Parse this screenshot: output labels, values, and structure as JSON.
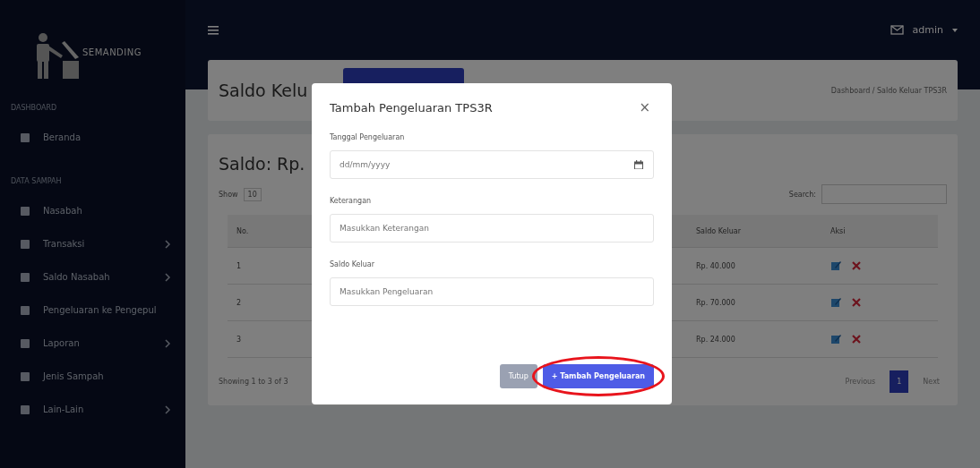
{
  "sidebar": {
    "brand": "SEMANDING",
    "items": [
      {
        "kind": "section",
        "label": "DASHBOARD"
      },
      {
        "kind": "link",
        "label": "Beranda",
        "expandable": false
      },
      {
        "kind": "section",
        "label": "DATA SAMPAH"
      },
      {
        "kind": "link",
        "label": "Nasabah",
        "expandable": false
      },
      {
        "kind": "link",
        "label": "Transaksi",
        "expandable": true
      },
      {
        "kind": "link",
        "label": "Saldo Nasabah",
        "expandable": true
      },
      {
        "kind": "link",
        "label": "Pengeluaran ke Pengepul",
        "expandable": false
      },
      {
        "kind": "link",
        "label": "Laporan",
        "expandable": true
      },
      {
        "kind": "link",
        "label": "Jenis Sampah",
        "expandable": false
      },
      {
        "kind": "link",
        "label": "Lain-Lain",
        "expandable": true
      }
    ]
  },
  "topbar": {
    "user": "admin"
  },
  "page_header": {
    "title": "Saldo Kelu",
    "breadcrumb": "Dashboard / Saldo Keluar TPS3R"
  },
  "card": {
    "title": "Saldo: Rp.",
    "show_label": "Show",
    "show_value": "10",
    "search_label": "Search:",
    "table": {
      "columns": [
        "No.",
        "Saldo Keluar",
        "Aksi"
      ],
      "rows": [
        {
          "no": "1",
          "amount": "Rp. 40.000"
        },
        {
          "no": "2",
          "amount": "Rp. 70.000"
        },
        {
          "no": "3",
          "amount": "Rp. 24.000"
        }
      ]
    },
    "info": "Showing 1 to 3 of 3",
    "pagination": [
      {
        "label": "Previous",
        "selected": false
      },
      {
        "label": "1",
        "selected": true
      },
      {
        "label": "Next",
        "selected": false
      }
    ]
  },
  "modal": {
    "title": "Tambah Pengeluaran TPS3R",
    "close": "×",
    "fields": [
      {
        "label": "Tanggal Pengeluaran",
        "kind": "date",
        "value": "dd/mm/yyyy"
      },
      {
        "label": "Keterangan",
        "kind": "text",
        "placeholder": "Masukkan Keterangan"
      },
      {
        "label": "Saldo Keluar",
        "kind": "text",
        "placeholder": "Masukkan Pengeluaran"
      }
    ],
    "buttons": [
      {
        "label": "Tutup",
        "kind": "secondary",
        "highlighted": false
      },
      {
        "label": "+ Tambah Pengeluaran",
        "kind": "primary",
        "highlighted": true
      }
    ]
  }
}
